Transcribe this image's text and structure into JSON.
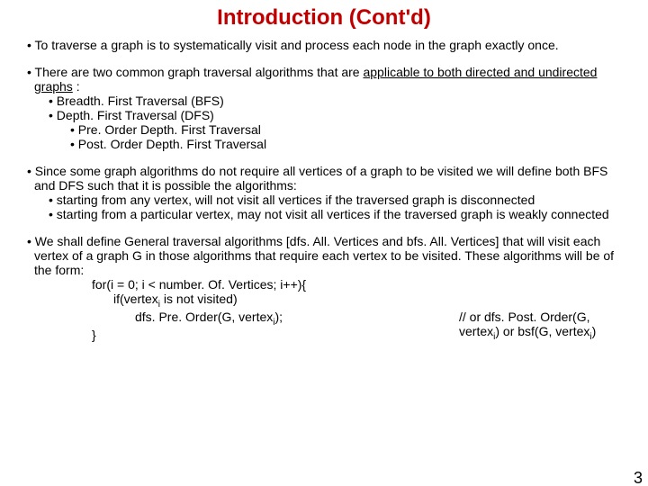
{
  "title": "Introduction (Cont'd)",
  "b1": {
    "text": "To traverse a graph is to systematically visit and process each node in the graph exactly once."
  },
  "b2": {
    "intro_pre": "There are two common graph traversal algorithms that are ",
    "under1": "applicable to both directed and undirected graphs",
    "colon": " :",
    "bfs": "Breadth. First Traversal (BFS)",
    "dfs": "Depth. First Traversal (DFS)",
    "pre": "Pre. Order Depth. First Traversal",
    "post": "Post. Order Depth. First Traversal"
  },
  "b3": {
    "intro": "Since some graph algorithms do not require all vertices of a graph to be visited we will define both BFS and DFS such that it is possible the algorithms:",
    "s1": "starting from any vertex, will not visit all vertices if the traversed graph is disconnected",
    "s2": "starting from a particular vertex, may not visit all vertices if the traversed graph is weakly connected"
  },
  "b4": {
    "intro": "We shall define General traversal algorithms [dfs. All. Vertices and bfs. All. Vertices] that will visit each vertex of a graph G in those algorithms that require each vertex to be visited. These algorithms will be of the form:",
    "c1": "for(i = 0; i < number. Of. Vertices; i++){",
    "c2_pre": "if(vertex",
    "c2_sub": "i",
    "c2_post": " is not visited)",
    "c3_pre": "dfs. Pre. Order(G, vertex",
    "c3_sub": "i",
    "c3_post": ");",
    "comment_pre": "// or  dfs. Post. Order(G, vertex",
    "comment_sub1": "i",
    "comment_mid": ")   or     bsf(G, vertex",
    "comment_sub2": "i",
    "comment_post": ")",
    "c4": "}"
  },
  "pagenum": "3"
}
